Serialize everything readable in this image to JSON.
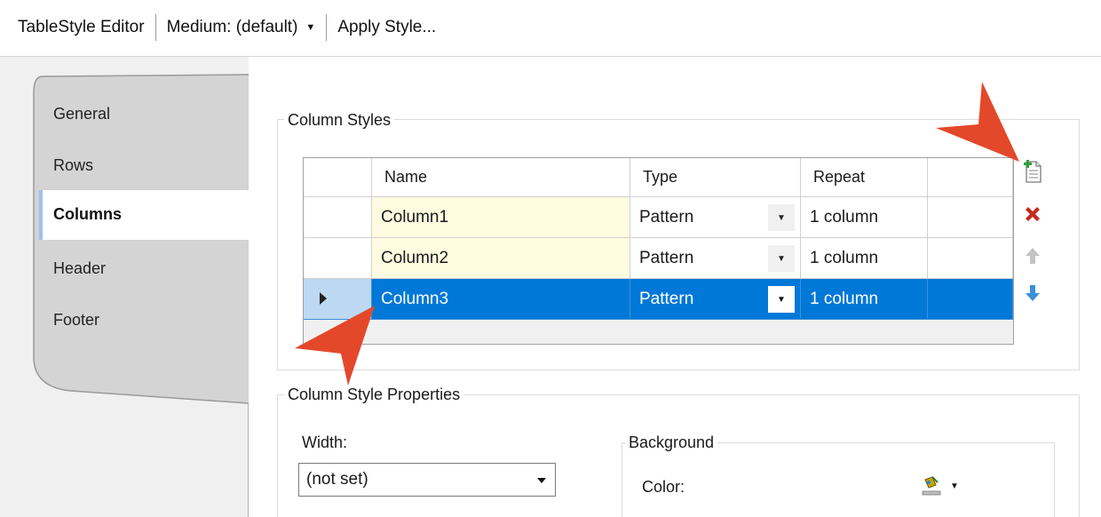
{
  "toolbar": {
    "editor_label": "TableStyle Editor",
    "style_selector": "Medium: (default)",
    "apply_label": "Apply Style..."
  },
  "tabs": [
    {
      "label": "General",
      "active": false
    },
    {
      "label": "Rows",
      "active": false
    },
    {
      "label": "Columns",
      "active": true
    },
    {
      "label": "Header",
      "active": false
    },
    {
      "label": "Footer",
      "active": false
    }
  ],
  "column_styles": {
    "group_label": "Column Styles",
    "headers": [
      "Name",
      "Type",
      "Repeat"
    ],
    "rows": [
      {
        "name": "Column1",
        "type": "Pattern",
        "repeat": "1 column",
        "selected": false
      },
      {
        "name": "Column2",
        "type": "Pattern",
        "repeat": "1 column",
        "selected": false
      },
      {
        "name": "Column3",
        "type": "Pattern",
        "repeat": "1 column",
        "selected": true
      }
    ],
    "buttons": {
      "add": "add-column-style-icon",
      "delete": "delete-column-style-icon",
      "move_up": "move-up-icon",
      "move_down": "move-down-icon"
    }
  },
  "properties": {
    "group_label": "Column Style Properties",
    "width_label": "Width:",
    "width_value": "(not set)",
    "background_label": "Background",
    "color_label": "Color:"
  },
  "colors": {
    "selection": "#0078d7",
    "name_cell": "#fffbe0",
    "callout_arrow": "#e4482a",
    "delete_red": "#c42b1c",
    "move_down_blue": "#3a8fd9"
  }
}
